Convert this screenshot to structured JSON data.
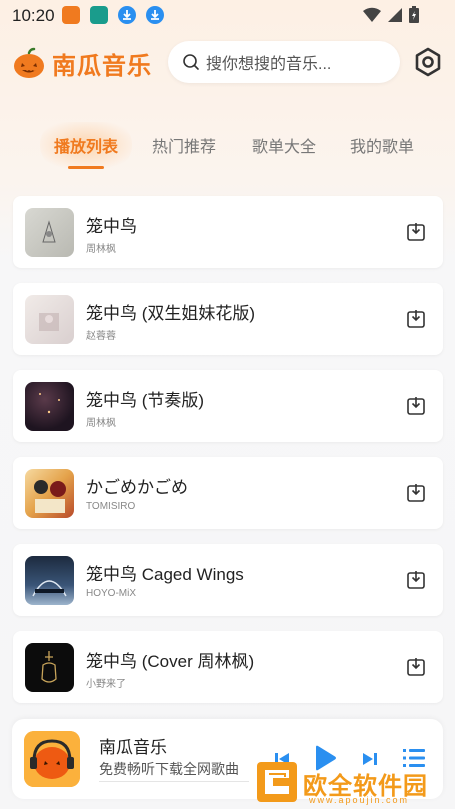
{
  "status_bar": {
    "time": "10:20"
  },
  "header": {
    "app_title": "南瓜音乐",
    "search_placeholder": "搜你想搜的音乐..."
  },
  "tabs": [
    {
      "label": "播放列表",
      "active": true
    },
    {
      "label": "热门推荐",
      "active": false
    },
    {
      "label": "歌单大全",
      "active": false
    },
    {
      "label": "我的歌单",
      "active": false
    }
  ],
  "songs": [
    {
      "title": "笼中鸟",
      "artist": "周林枫"
    },
    {
      "title": "笼中鸟 (双生姐妹花版)",
      "artist": "赵蓉蓉"
    },
    {
      "title": "笼中鸟 (节奏版)",
      "artist": "周林枫"
    },
    {
      "title": "かごめかごめ",
      "artist": "TOMISIRO"
    },
    {
      "title": "笼中鸟 Caged Wings",
      "artist": "HOYO-MiX"
    },
    {
      "title": "笼中鸟 (Cover 周林枫)",
      "artist": "小野来了"
    }
  ],
  "player": {
    "title": "南瓜音乐",
    "subtitle": "免费畅听下载全网歌曲"
  },
  "watermark": {
    "text": "欧全软件园",
    "url": "www.apoujin.com"
  },
  "colors": {
    "accent": "#f07a1f",
    "play_blue": "#2a8ff0"
  }
}
